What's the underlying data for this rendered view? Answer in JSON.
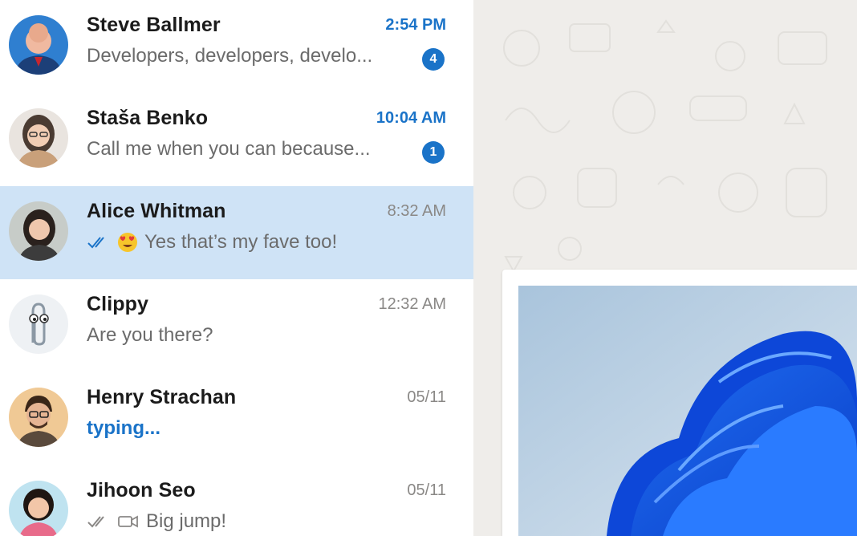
{
  "chats": [
    {
      "name": "Steve Ballmer",
      "time": "2:54 PM",
      "preview": "Developers, developers, develo...",
      "unread": "4",
      "avatar": "steve-ballmer-avatar"
    },
    {
      "name": "Staša Benko",
      "time": "10:04 AM",
      "preview": "Call me when you can because...",
      "unread": "1",
      "avatar": "stasa-benko-avatar"
    },
    {
      "name": "Alice Whitman",
      "time": "8:32 AM",
      "preview": "Yes that’s my fave too!",
      "preview_icons": [
        "double-check-icon",
        "heart-eyes-emoji-icon"
      ],
      "avatar": "alice-whitman-avatar"
    },
    {
      "name": "Clippy",
      "time": "12:32 AM",
      "preview": "Are you there?",
      "avatar": "clippy-avatar"
    },
    {
      "name": "Henry Strachan",
      "time": "05/11",
      "preview": "typing...",
      "avatar": "henry-strachan-avatar"
    },
    {
      "name": "Jihoon Seo",
      "time": "05/11",
      "preview": "Big jump!",
      "preview_icons": [
        "double-check-icon",
        "video-icon"
      ],
      "avatar": "jihoon-seo-avatar"
    }
  ],
  "colors": {
    "accent": "#1a73c8",
    "selected_row": "#cfe3f6",
    "conversation_bg": "#efedea"
  },
  "media": {
    "image_icon": "windows-bloom-image"
  }
}
